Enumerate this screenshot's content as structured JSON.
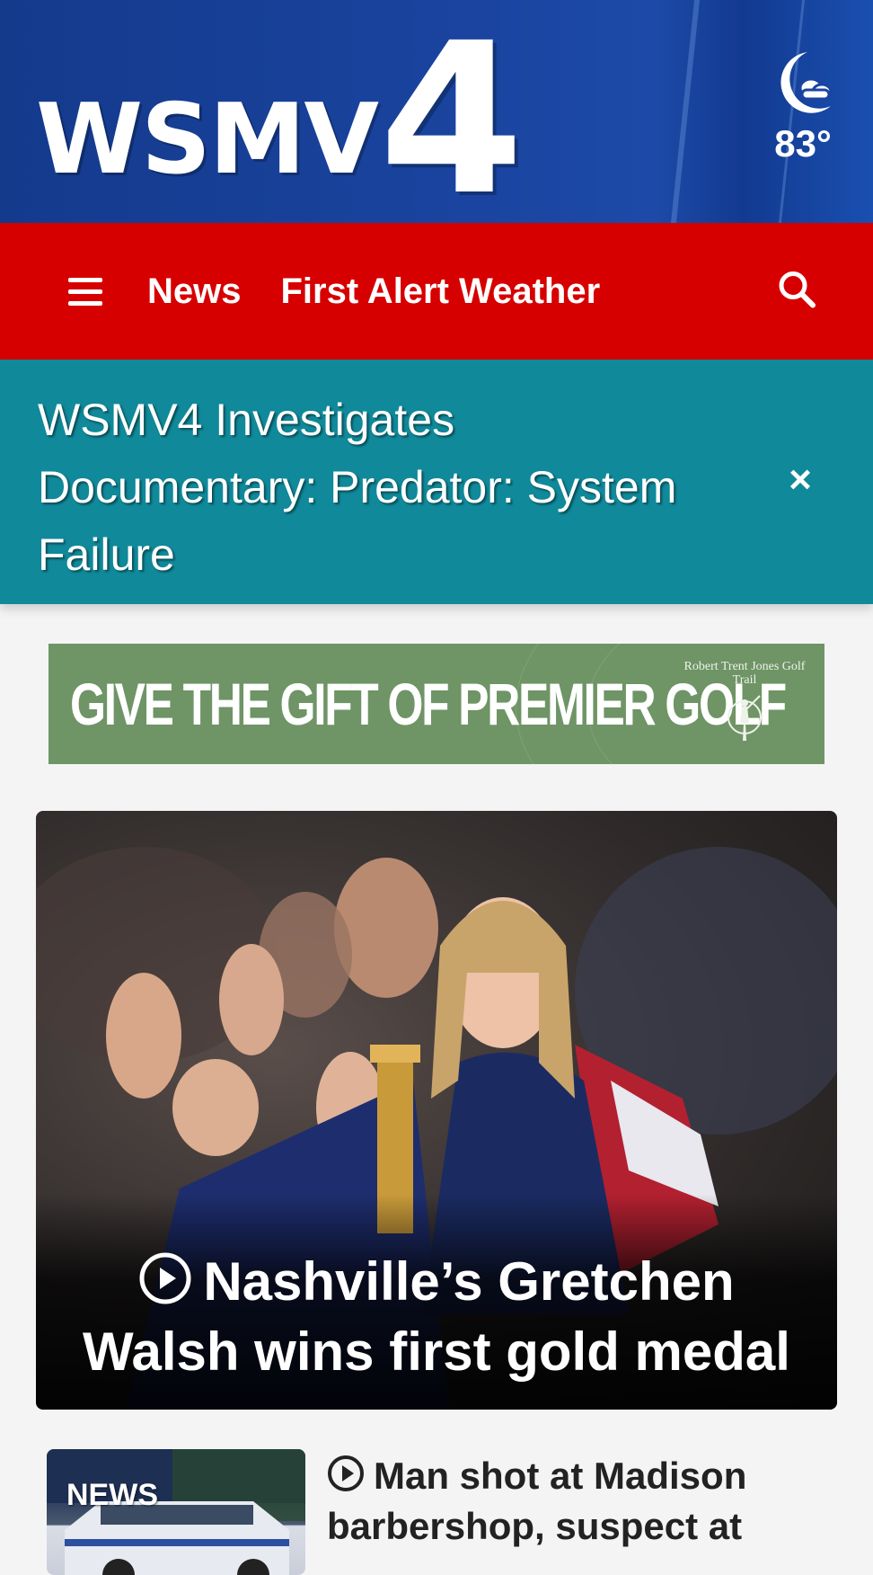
{
  "header": {
    "logo_text": "WSMV",
    "logo_number": "4",
    "weather": {
      "icon": "moon-cloud-icon",
      "temperature": "83°"
    }
  },
  "nav": {
    "menu_icon": "hamburger-menu-icon",
    "links": [
      {
        "label": "News"
      },
      {
        "label": "First Alert Weather"
      }
    ],
    "search_icon": "search-icon"
  },
  "banner": {
    "text": "WSMV4 Investigates Documentary: Predator: System Failure",
    "close_label": "×"
  },
  "ad": {
    "headline": "GIVE THE GIFT OF PREMIER GOLF",
    "brand": "Robert Trent Jones Golf Trail"
  },
  "hero": {
    "headline": "Nashville’s Gretchen Walsh wins first gold medal",
    "has_video": true
  },
  "stories": [
    {
      "thumb_label": "NEWS",
      "title": "Man shot at Madison barbershop, suspect at",
      "has_video": true
    }
  ],
  "colors": {
    "brand_blue": "#1a44a0",
    "nav_red": "#d60000",
    "banner_teal": "#10899a",
    "ad_green": "#6f9466"
  }
}
